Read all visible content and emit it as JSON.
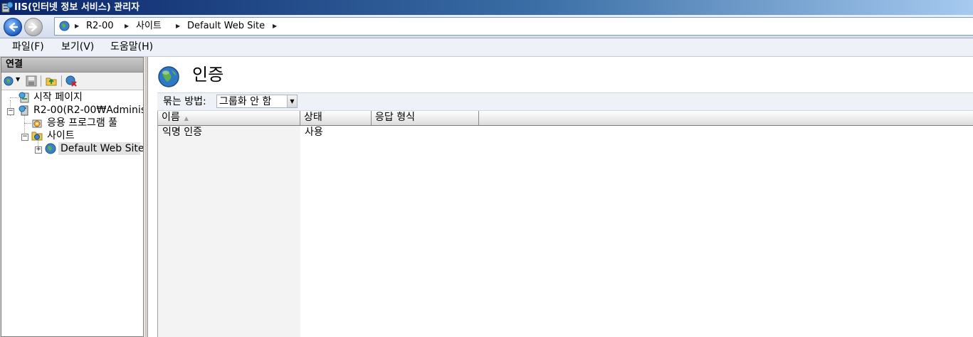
{
  "window": {
    "title": "IIS(인터넷 정보 서비스) 관리자"
  },
  "navigation": {
    "back_icon": "back-arrow-icon",
    "forward_icon": "forward-arrow-icon",
    "breadcrumbs": [
      "R2-00",
      "사이트",
      "Default Web Site"
    ]
  },
  "menu": {
    "items": [
      "파일(F)",
      "보기(V)",
      "도움말(H)"
    ]
  },
  "connections": {
    "header": "연결",
    "toolbar_icons": [
      "connect-icon",
      "save-icon",
      "up-folder-icon",
      "delete-connection-icon"
    ],
    "tree": [
      {
        "label": "시작 페이지",
        "icon": "start-page-icon"
      },
      {
        "label": "R2-00(R2-00₩Administ",
        "icon": "server-icon"
      },
      {
        "label": "응용 프로그램 풀",
        "icon": "app-pool-icon"
      },
      {
        "label": "사이트",
        "icon": "sites-folder-icon"
      },
      {
        "label": "Default Web Site",
        "icon": "globe-icon",
        "selected": true
      }
    ]
  },
  "main": {
    "title": "인증",
    "group_by_label": "묶는 방법:",
    "group_by_value": "그룹화 안 함",
    "columns": [
      "이름",
      "상태",
      "응답 형식"
    ],
    "rows": [
      {
        "name": "익명 인증",
        "status": "사용",
        "response": ""
      }
    ]
  },
  "colors": {
    "titlebar_start": "#0a246a",
    "titlebar_end": "#a6caf0",
    "selection": "#e3e3e3"
  }
}
